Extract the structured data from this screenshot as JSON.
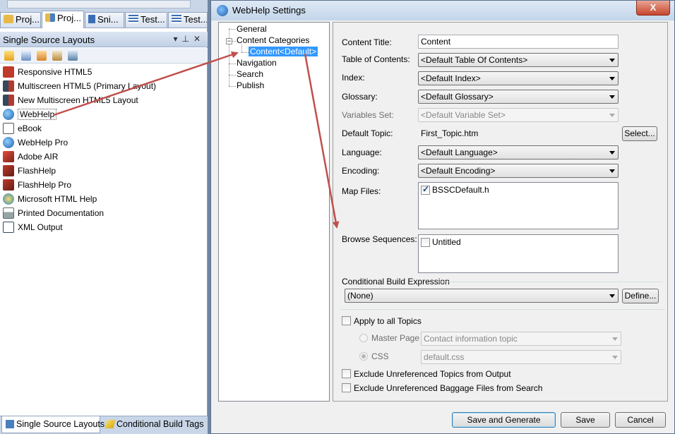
{
  "top_tabs": [
    {
      "label": "Proj...",
      "active": false
    },
    {
      "label": "Proj...",
      "active": true
    },
    {
      "label": "Sni...",
      "active": false
    },
    {
      "label": "Test...",
      "active": false
    },
    {
      "label": "Test...",
      "active": false
    }
  ],
  "ssl_panel": {
    "title": "Single Source Layouts",
    "items": [
      {
        "label": "Responsive HTML5",
        "icon": "responsive-html5-icon",
        "color": "#c0392b"
      },
      {
        "label": "Multiscreen HTML5 (Primary Layout)",
        "icon": "multiscreen-icon",
        "color": "#b03a2e"
      },
      {
        "label": "New Multiscreen HTML5 Layout",
        "icon": "multiscreen-icon",
        "color": "#b03a2e"
      },
      {
        "label": "WebHelp",
        "icon": "globe-icon",
        "color": "#2e86c1"
      },
      {
        "label": "eBook",
        "icon": "ebook-icon",
        "color": "#555555"
      },
      {
        "label": "WebHelp Pro",
        "icon": "globe-icon",
        "color": "#2e86c1"
      },
      {
        "label": "Adobe AIR",
        "icon": "adobe-air-icon",
        "color": "#a93226"
      },
      {
        "label": "FlashHelp",
        "icon": "flash-icon",
        "color": "#922b21"
      },
      {
        "label": "FlashHelp Pro",
        "icon": "flash-icon",
        "color": "#922b21"
      },
      {
        "label": "Microsoft HTML Help",
        "icon": "html-help-icon",
        "color": "#d4ac0d"
      },
      {
        "label": "Printed Documentation",
        "icon": "printer-icon",
        "color": "#7f8c8d"
      },
      {
        "label": "XML Output",
        "icon": "xml-icon",
        "color": "#34495e"
      }
    ],
    "selected_label": "WebHelp"
  },
  "bottom_tabs": [
    {
      "label": "Single Source Layouts",
      "active": true
    },
    {
      "label": "Conditional Build Tags",
      "active": false
    }
  ],
  "dialog": {
    "title": "WebHelp Settings",
    "close_label": "X",
    "tree": {
      "general": "General",
      "content_categories": "Content Categories",
      "content_default": "Content<Default>",
      "navigation": "Navigation",
      "search": "Search",
      "publish": "Publish",
      "expander": "−"
    },
    "form": {
      "content_title_label": "Content Title:",
      "content_title_value": "Content",
      "toc_label": "Table of Contents:",
      "toc_value": "<Default Table Of Contents>",
      "index_label": "Index:",
      "index_value": "<Default Index>",
      "glossary_label": "Glossary:",
      "glossary_value": "<Default Glossary>",
      "variables_label": "Variables Set:",
      "variables_value": "<Default Variable Set>",
      "default_topic_label": "Default Topic:",
      "default_topic_value": "First_Topic.htm",
      "select_button": "Select...",
      "language_label": "Language:",
      "language_value": "<Default Language>",
      "encoding_label": "Encoding:",
      "encoding_value": "<Default Encoding>",
      "map_files_label": "Map Files:",
      "map_file_item": "BSSCDefault.h",
      "browse_label": "Browse Sequences:",
      "browse_item": "Untitled",
      "cbe_label": "Conditional Build Expression",
      "cbe_value": "(None)",
      "define_button": "Define...",
      "apply_all_label": "Apply to all Topics",
      "master_page_label": "Master Page",
      "master_page_value": "Contact information topic",
      "css_label": "CSS",
      "css_value": "default.css",
      "exclude_topics_label": "Exclude Unreferenced Topics from Output",
      "exclude_baggage_label": "Exclude Unreferenced Baggage Files from Search"
    },
    "buttons": {
      "save_generate": "Save and Generate",
      "save": "Save",
      "cancel": "Cancel"
    }
  },
  "colors": {
    "annotation_arrow": "#c0504d",
    "selection": "#3399ff"
  }
}
